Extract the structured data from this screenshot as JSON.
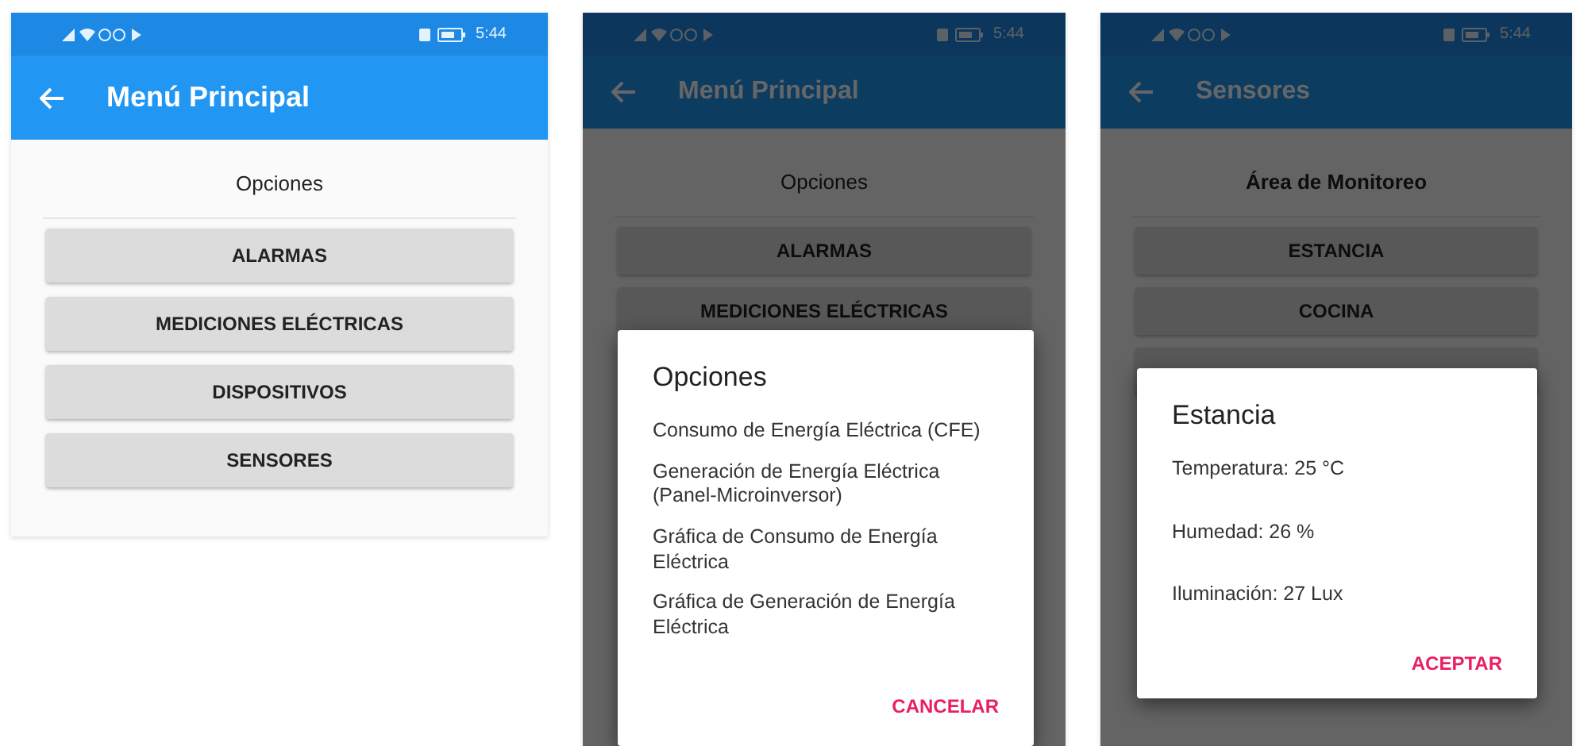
{
  "screens": [
    {
      "status_bar": {
        "time": "5:44"
      },
      "app_bar": {
        "title": "Menú Principal"
      },
      "heading": "Opciones",
      "heading_bold": false,
      "buttons": [
        {
          "label": "ALARMAS"
        },
        {
          "label": "MEDICIONES ELÉCTRICAS"
        },
        {
          "label": "DISPOSITIVOS"
        },
        {
          "label": "SENSORES"
        }
      ],
      "dimmed": false
    },
    {
      "status_bar": {
        "time": "5:44"
      },
      "app_bar": {
        "title": "Menú Principal"
      },
      "heading": "Opciones",
      "heading_bold": false,
      "buttons": [
        {
          "label": "ALARMAS"
        },
        {
          "label": "MEDICIONES ELÉCTRICAS"
        }
      ],
      "dimmed": true,
      "dialog": {
        "kind": "options",
        "title": "Opciones",
        "items": [
          "Consumo de Energía Eléctrica (CFE)",
          "Generación de Energía Eléctrica (Panel-Microinversor)",
          "Gráfica de Consumo de Energía Eléctrica",
          "Gráfica de Generación de Energía Eléctrica"
        ],
        "action": "CANCELAR"
      }
    },
    {
      "status_bar": {
        "time": "5:44"
      },
      "app_bar": {
        "title": "Sensores"
      },
      "heading": "Área de Monitoreo",
      "heading_bold": true,
      "buttons": [
        {
          "label": "ESTANCIA"
        },
        {
          "label": "COCINA"
        }
      ],
      "covered_button": true,
      "dimmed": true,
      "dialog": {
        "kind": "readings",
        "title": "Estancia",
        "items": [
          "Temperatura: 25 °C",
          "Humedad: 26 %",
          "Iluminación: 27 Lux"
        ],
        "action": "ACEPTAR"
      }
    }
  ]
}
